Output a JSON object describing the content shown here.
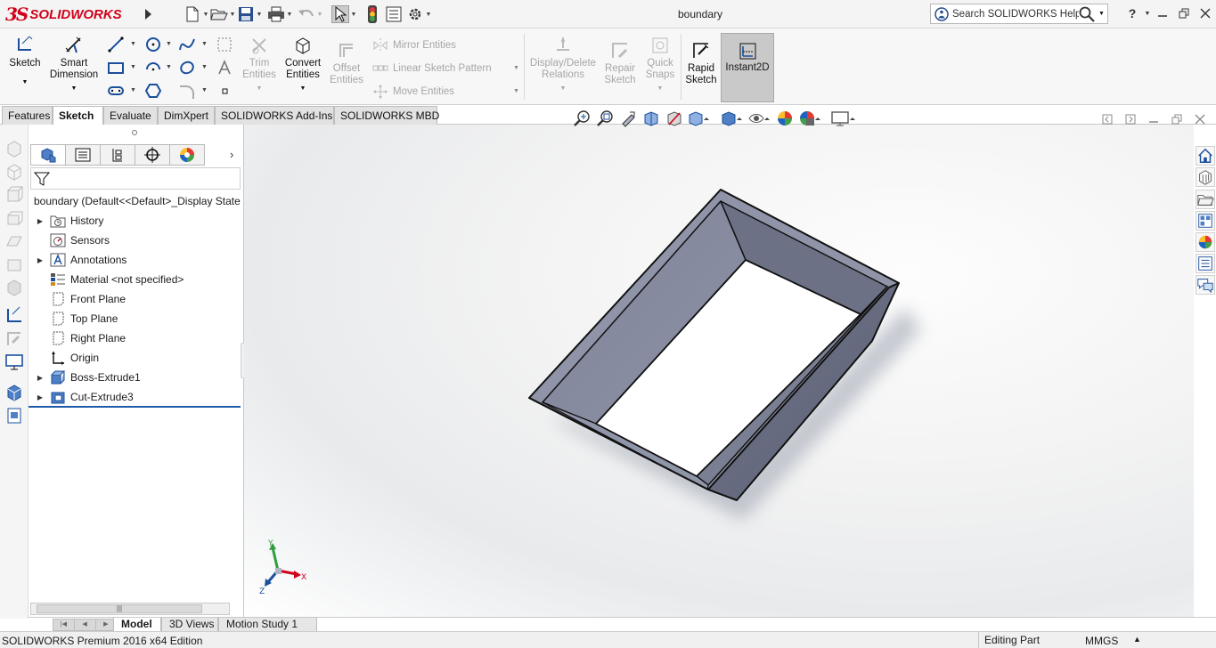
{
  "app": {
    "logo_mark": "3S",
    "logo_text": "SOLIDWORKS",
    "document_title": "boundary",
    "search_placeholder": "Search SOLIDWORKS Help",
    "help_label": "?"
  },
  "quick_access": {
    "icons": [
      "new-document-icon",
      "open-folder-icon",
      "save-icon",
      "print-icon",
      "undo-icon",
      "select-arrow-icon",
      "traffic-light-icon",
      "file-properties-icon",
      "options-gear-icon"
    ]
  },
  "command_manager": {
    "sketch": "Sketch",
    "smart_dimension": [
      "Smart",
      "Dimension"
    ],
    "trim_entities": [
      "Trim",
      "Entities"
    ],
    "convert_entities": [
      "Convert",
      "Entities"
    ],
    "offset_entities": [
      "Offset",
      "Entities"
    ],
    "mirror_entities": "Mirror Entities",
    "linear_sketch_pattern": "Linear Sketch Pattern",
    "move_entities": "Move Entities",
    "display_delete_relations": [
      "Display/Delete",
      "Relations"
    ],
    "repair_sketch": [
      "Repair",
      "Sketch"
    ],
    "quick_snaps": [
      "Quick",
      "Snaps"
    ],
    "rapid_sketch": [
      "Rapid",
      "Sketch"
    ],
    "instant2d": "Instant2D"
  },
  "tabs": [
    "Features",
    "Sketch",
    "Evaluate",
    "DimXpert",
    "SOLIDWORKS Add-Ins",
    "SOLIDWORKS MBD"
  ],
  "active_tab": "Sketch",
  "feature_tree": {
    "root_label": "boundary  (Default<<Default>_Display State 1>)",
    "items": [
      {
        "label": "History",
        "expandable": true
      },
      {
        "label": "Sensors",
        "expandable": false
      },
      {
        "label": "Annotations",
        "expandable": true
      },
      {
        "label": "Material <not specified>",
        "expandable": false
      },
      {
        "label": "Front Plane",
        "expandable": false
      },
      {
        "label": "Top Plane",
        "expandable": false
      },
      {
        "label": "Right Plane",
        "expandable": false
      },
      {
        "label": "Origin",
        "expandable": false
      },
      {
        "label": "Boss-Extrude1",
        "expandable": true
      },
      {
        "label": "Cut-Extrude3",
        "expandable": true
      }
    ]
  },
  "triad": {
    "x": "X",
    "y": "Y",
    "z": "Z"
  },
  "bottom_tabs": [
    "Model",
    "3D Views",
    "Motion Study 1"
  ],
  "active_bottom_tab": "Model",
  "status": {
    "product": "SOLIDWORKS Premium 2016 x64 Edition",
    "mode": "Editing Part",
    "units": "MMGS",
    "units_caret": "▲"
  },
  "colors": {
    "brand_red": "#d0021b",
    "part_face": "#8a8fa3",
    "part_face_dark": "#6b7085",
    "part_face_light": "#a7abbb",
    "selection_blue": "#1f5aa8"
  }
}
